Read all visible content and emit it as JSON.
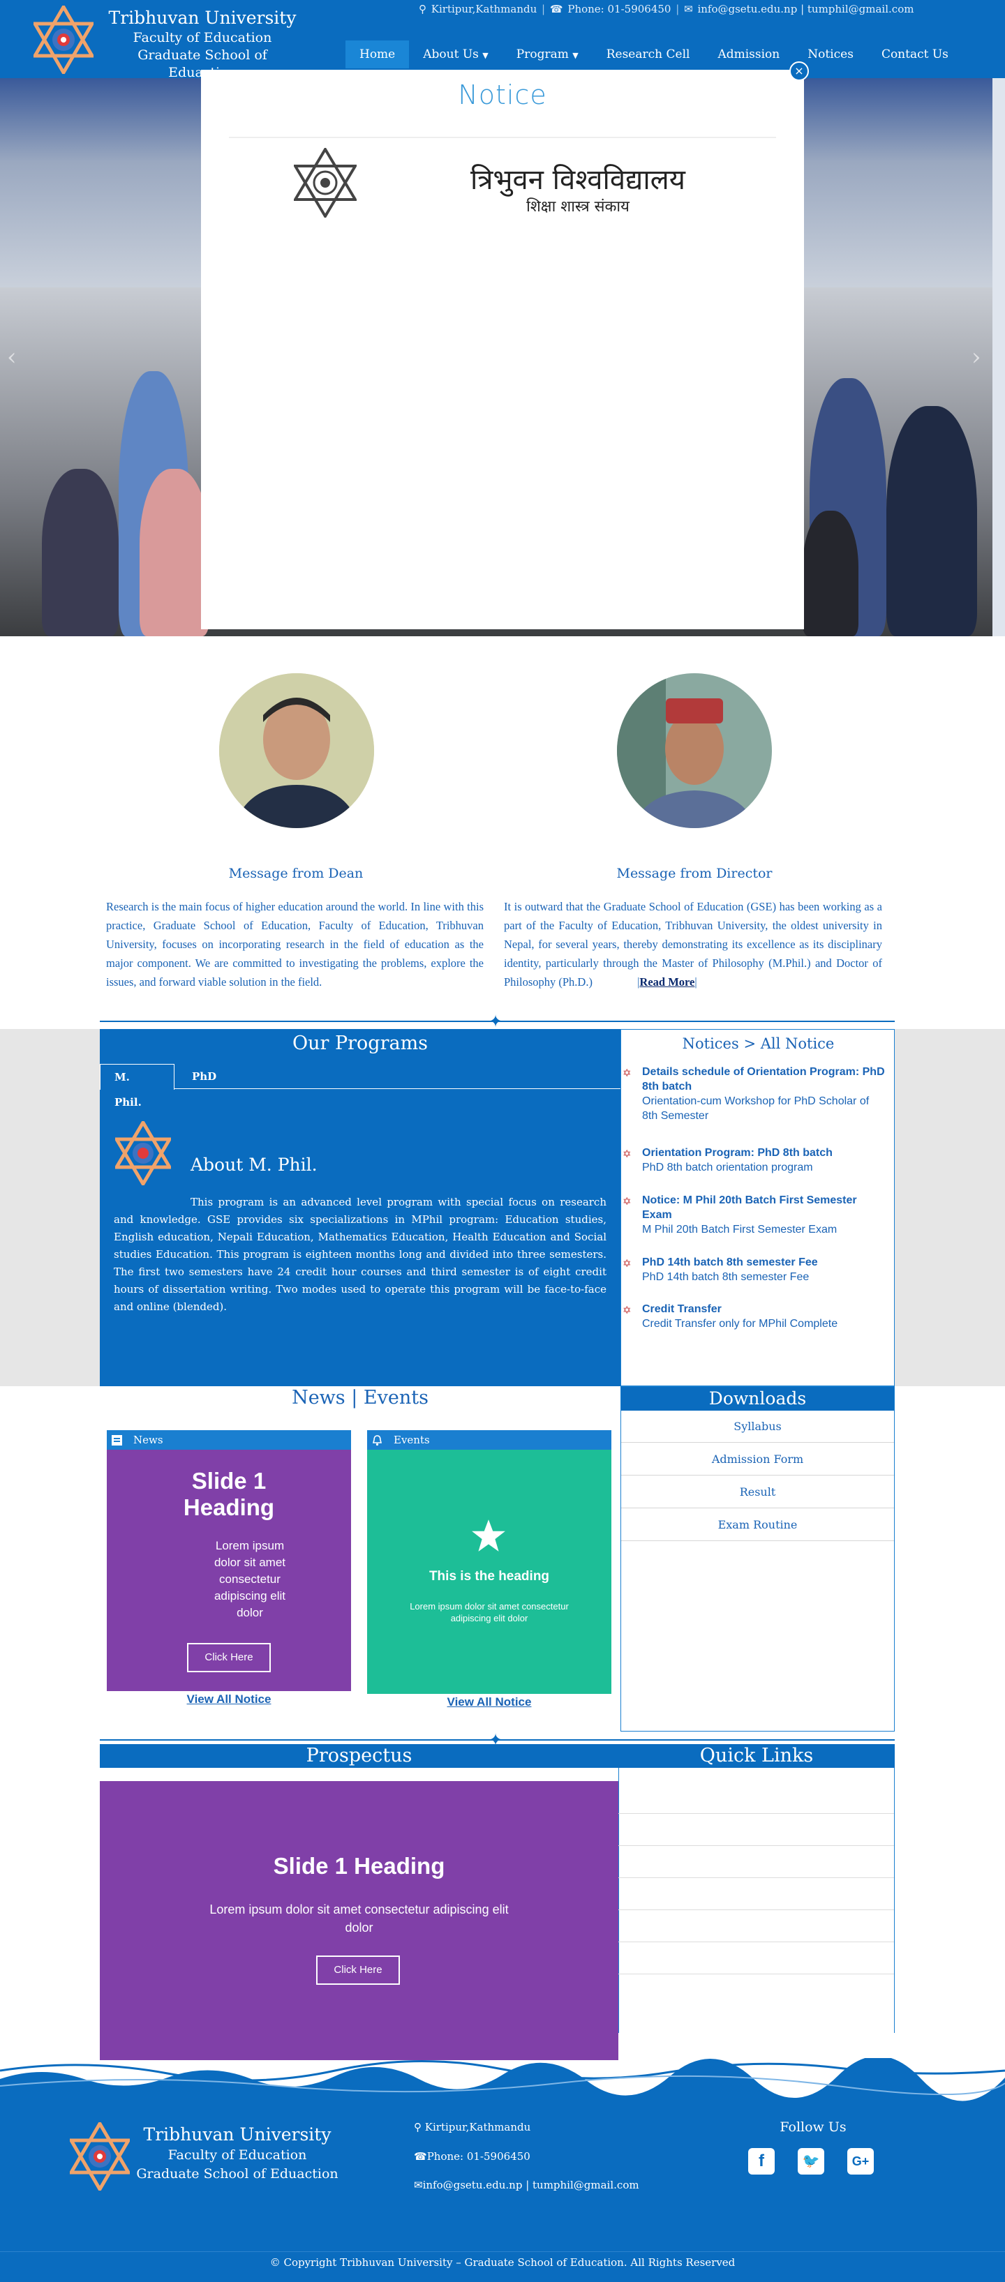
{
  "header": {
    "title": "Tribhuvan University",
    "subtitle1": "Faculty of Education",
    "subtitle2": "Graduate School of Eduaction",
    "location": "Kirtipur,Kathmandu",
    "phone": "Phone: 01-5906450",
    "emails": "info@gsetu.edu.np | tumphil@gmail.com",
    "nav": [
      "Home",
      "About Us",
      "Program",
      "Research Cell",
      "Admission",
      "Notices",
      "Contact Us"
    ]
  },
  "modal": {
    "title": "Notice",
    "close": "×",
    "notice_head1": "त्रिभुवन विश्वविद्यालय",
    "notice_head2": "शिक्षा शास्त्र संकाय"
  },
  "messages": {
    "dean_title": "Message from Dean",
    "dean_text": "Research is the main focus of higher education around the world. In line with this practice, Graduate School of Education, Faculty of Education, Tribhuvan University, focuses on incorporating research in the field of education as the major component. We are committed to investigating the problems, explore the issues, and forward viable solution in the field.",
    "director_title": "Message from Director",
    "director_text": "It is outward that the Graduate School of Education (GSE) has been working as a part of the Faculty of Education, Tribhuvan University, the oldest university in Nepal, for several years, thereby demonstrating its excellence as its disciplinary identity, particularly through the Master of Philosophy (M.Phil.) and Doctor of Philosophy (Ph.D.)",
    "read_more": "Read More"
  },
  "programs": {
    "title": "Our Programs",
    "tabs": [
      "M. Phil.",
      "PhD"
    ],
    "heading": "About M. Phil.",
    "text": "This program is an advanced level program with special focus on research and knowledge. GSE provides six specializations in MPhil program: Education studies, English education, Nepali Education, Mathematics Education, Health Education and Social studies Education. This program is eighteen months long and divided into three semesters. The first two semesters have 24 credit hour courses and third semester is of eight credit hours of dissertation writing. Two modes used to operate this program will be face-to-face and online (blended)."
  },
  "notices": {
    "title": "Notices > All Notice",
    "items": [
      {
        "title": "Details schedule of Orientation Program: PhD 8th batch",
        "desc": "Orientation-cum Workshop for PhD Scholar of 8th Semester"
      },
      {
        "title": "Orientation Program: PhD 8th batch",
        "desc": "PhD 8th batch orientation program"
      },
      {
        "title": "Notice: M Phil 20th Batch First Semester Exam",
        "desc": "M Phil 20th Batch First Semester Exam"
      },
      {
        "title": "PhD 14th batch 8th semester Fee",
        "desc": "PhD 14th batch 8th semester Fee"
      },
      {
        "title": "Credit Transfer",
        "desc": "Credit Transfer only for MPhil Complete"
      }
    ]
  },
  "news_events": {
    "title": "News | Events",
    "news_label": "News",
    "news_slide_heading": "Slide 1 Heading",
    "news_slide_text": "Lorem ipsum dolor sit amet consectetur adipiscing elit dolor",
    "news_button": "Click Here",
    "news_view_all": "View All Notice",
    "events_label": "Events",
    "events_heading": "This is the heading",
    "events_text": "Lorem ipsum dolor sit amet consectetur adipiscing elit dolor",
    "events_view_all": "View All Notice"
  },
  "downloads": {
    "title": "Downloads",
    "items": [
      "Syllabus",
      "Admission Form",
      "Result",
      "Exam Routine"
    ]
  },
  "prospectus": {
    "title": "Prospectus",
    "slide_heading": "Slide 1 Heading",
    "slide_text": "Lorem ipsum dolor sit amet consectetur adipiscing elit dolor",
    "button": "Click Here"
  },
  "quick_links": {
    "title": "Quick Links"
  },
  "footer": {
    "title": "Tribhuvan University",
    "subtitle1": "Faculty of Education",
    "subtitle2": "Graduate School of Eduaction",
    "location": "Kirtipur,Kathmandu",
    "phone": "Phone: 01-5906450",
    "emails": "info@gsetu.edu.np | tumphil@gmail.com",
    "follow": "Follow Us",
    "social": [
      "facebook-icon",
      "twitter-icon",
      "google-plus-icon"
    ],
    "copyright": "© Copyright Tribhuvan University – Graduate School of Education. All Rights Reserved"
  },
  "colors": {
    "primary": "#0a6cbf",
    "slide_purple": "#8040a8",
    "slide_teal": "#1dbe97"
  }
}
